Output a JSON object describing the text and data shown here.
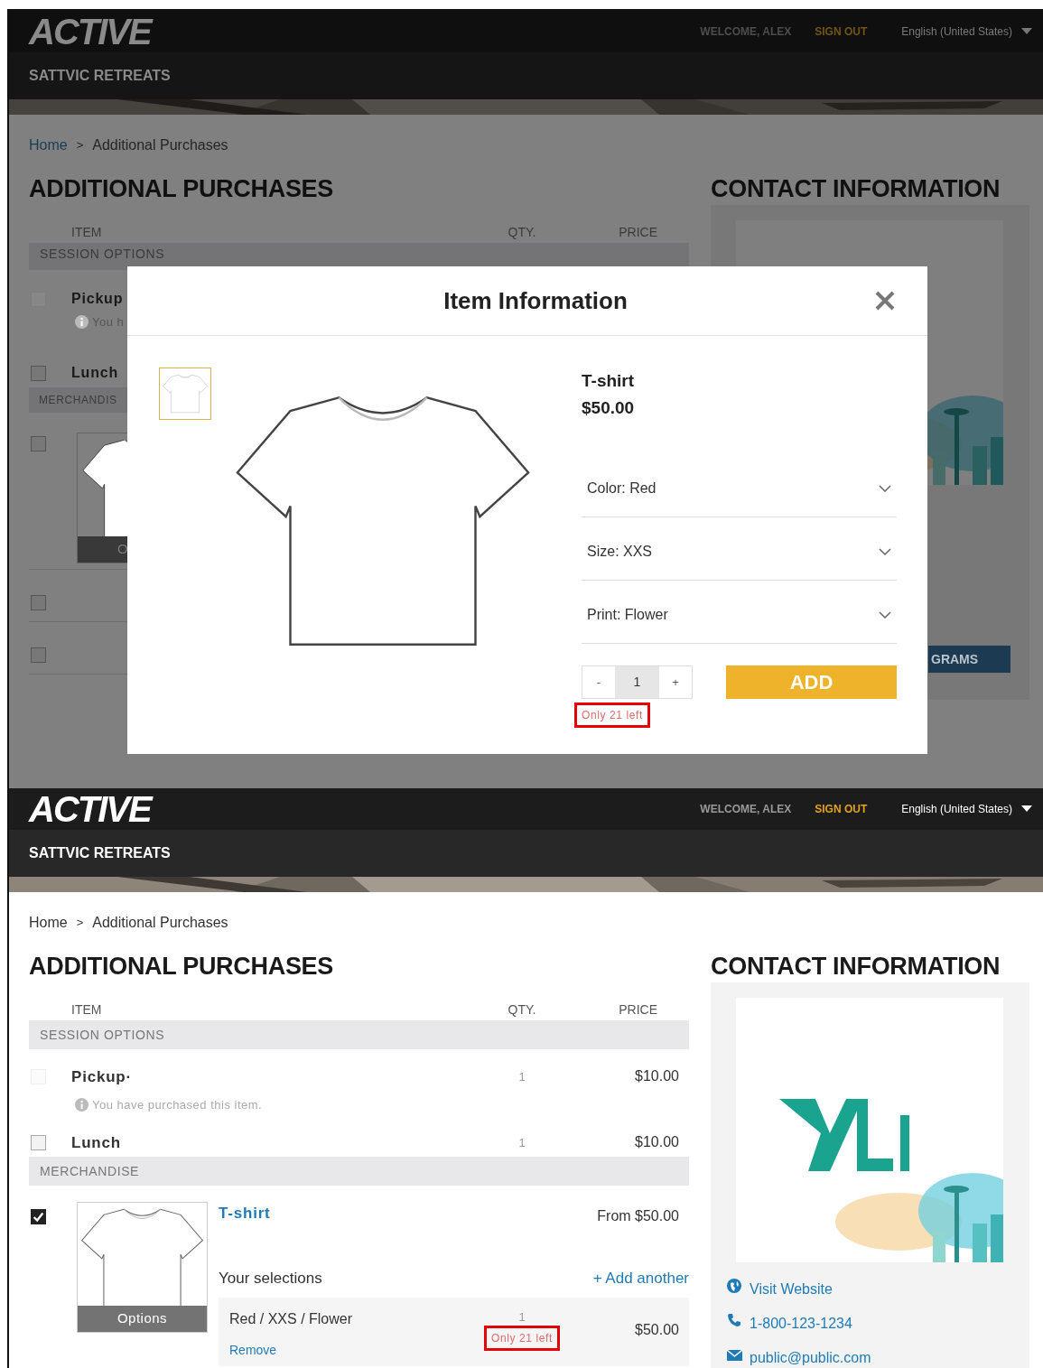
{
  "modal_screen": {
    "header": {
      "logo": "ACTIVE",
      "welcome": "WELCOME, ALEX",
      "sign_out": "SIGN OUT",
      "language": "English (United States)",
      "org_name": "SATTVIC RETREATS"
    },
    "breadcrumb": {
      "items": [
        "Home",
        "Additional Purchases"
      ],
      "separator": ">"
    },
    "heading": "ADDITIONAL PURCHASES",
    "contact_heading": "CONTACT INFORMATION",
    "columns": [
      "ITEM",
      "QTY.",
      "PRICE"
    ],
    "section": "SESSION OPTIONS",
    "rows": [
      {
        "kind": "item",
        "label": "Pickup",
        "note": "You h",
        "checked": false,
        "disabled": true
      },
      {
        "kind": "item",
        "label": "Lunch",
        "checked": false,
        "disabled": false
      },
      {
        "kind": "section",
        "label": "MERCHANDIS"
      },
      {
        "kind": "merch",
        "thumb_label": "O",
        "checked": false,
        "disabled": false
      },
      {
        "kind": "blank",
        "checked": false,
        "disabled": false
      },
      {
        "kind": "blank",
        "checked": false,
        "disabled": false
      }
    ],
    "side_button": "GRAMS",
    "modal": {
      "title": "Item Information",
      "product": "T-shirt",
      "price": "$50.00",
      "thumbnails": [
        {
          "selected": true
        }
      ],
      "options": [
        {
          "label": "Color: Red"
        },
        {
          "label": "Size: XXS"
        },
        {
          "label": "Print: Flower"
        }
      ],
      "quantity": {
        "minus": "-",
        "value": "1",
        "plus": "+"
      },
      "add": "ADD",
      "stock_note": {
        "label": "Only 21 left",
        "highlighted": true
      }
    }
  },
  "page_screen": {
    "header": {
      "logo": "ACTIVE",
      "welcome": "WELCOME, ALEX",
      "sign_out": "SIGN OUT",
      "language": "English (United States)",
      "org_name": "SATTVIC RETREATS"
    },
    "breadcrumb": {
      "items": [
        "Home",
        "Additional Purchases"
      ],
      "separator": ">"
    },
    "heading": "ADDITIONAL PURCHASES",
    "contact_heading": "CONTACT INFORMATION",
    "columns": [
      "ITEM",
      "QTY.",
      "PRICE"
    ],
    "sections": [
      {
        "label": "SESSION OPTIONS",
        "items": [
          {
            "kind": "simple",
            "name": "Pickup·",
            "note": "You have purchased this item.",
            "qty": "1",
            "price": "$10.00",
            "checked": false,
            "disabled": true
          },
          {
            "kind": "simple",
            "name": "Lunch",
            "qty": "1",
            "price": "$10.00",
            "checked": false,
            "disabled": false
          }
        ]
      },
      {
        "label": "MERCHANDISE",
        "items": [
          {
            "kind": "merch",
            "name": "T-shirt",
            "price": "From $50.00",
            "checked": true,
            "disabled": false,
            "thumb_label": "Options",
            "selections_label": "Your selections",
            "add_another": "+ Add another",
            "selections": [
              {
                "label": "Red / XXS / Flower",
                "remove": "Remove",
                "qty": "1",
                "stock_note": {
                  "label": "Only 21 left",
                  "highlighted": true
                },
                "price": "$50.00"
              }
            ]
          }
        ]
      }
    ],
    "contact": {
      "links": [
        {
          "kind": "web",
          "label": "Visit Website"
        },
        {
          "kind": "phone",
          "label": "1-800-123-1234"
        },
        {
          "kind": "mail",
          "label": "public@public.com"
        }
      ]
    }
  }
}
